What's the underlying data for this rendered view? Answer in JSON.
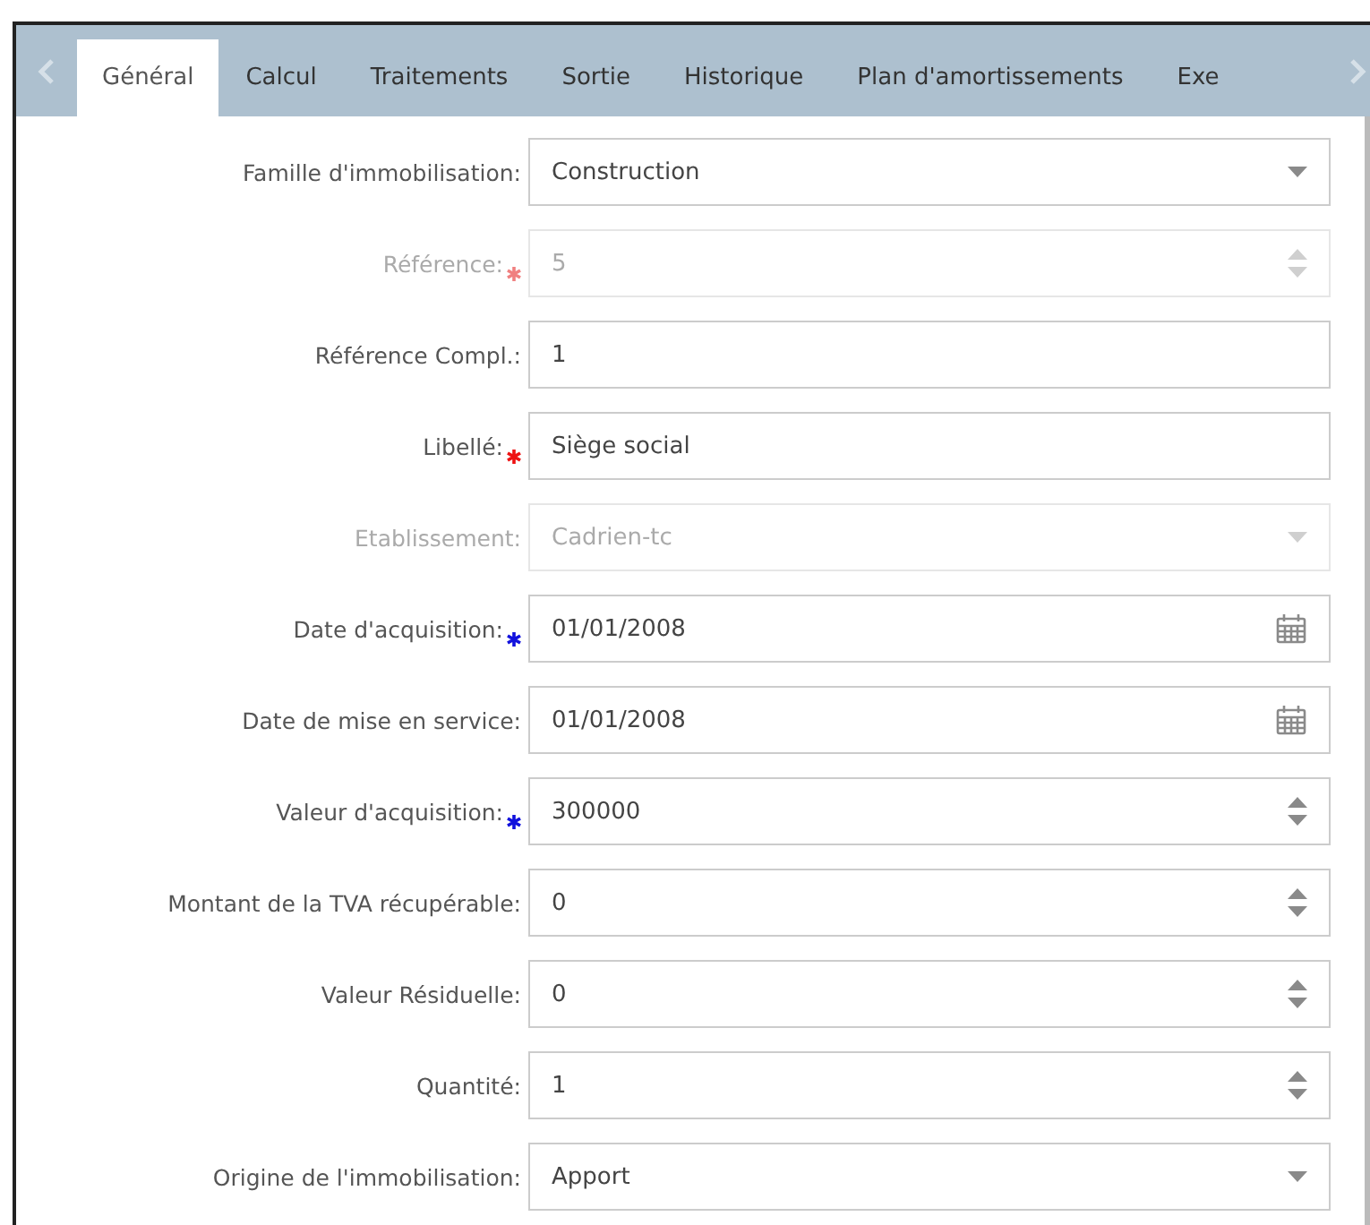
{
  "tabs": [
    {
      "label": "Général",
      "selected": true
    },
    {
      "label": "Calcul",
      "selected": false
    },
    {
      "label": "Traitements",
      "selected": false
    },
    {
      "label": "Sortie",
      "selected": false
    },
    {
      "label": "Historique",
      "selected": false
    },
    {
      "label": "Plan d'amortissements",
      "selected": false
    },
    {
      "label": "Exe",
      "selected": false
    }
  ],
  "fields": [
    {
      "label": "Famille d'immobilisation:",
      "value": "Construction",
      "kind": "select",
      "disabled": false,
      "required": false
    },
    {
      "label": "Référence:",
      "value": "5",
      "kind": "number",
      "disabled": true,
      "required": true,
      "color": "#f08080"
    },
    {
      "label": "Référence Compl.:",
      "value": "1",
      "kind": "text",
      "disabled": false,
      "required": false
    },
    {
      "label": "Libellé:",
      "value": "Siège social",
      "kind": "text",
      "disabled": false,
      "required": true,
      "color": "#ee1111"
    },
    {
      "label": "Etablissement:",
      "value": "Cadrien-tc",
      "kind": "select",
      "disabled": true,
      "required": false
    },
    {
      "label": "Date d'acquisition:",
      "value": "01/01/2008",
      "kind": "date",
      "disabled": false,
      "required": true,
      "color": "#1111dd"
    },
    {
      "label": "Date de mise en service:",
      "value": "01/01/2008",
      "kind": "date",
      "disabled": false,
      "required": false
    },
    {
      "label": "Valeur d'acquisition:",
      "value": "300000",
      "kind": "number",
      "disabled": false,
      "required": true,
      "color": "#1111dd"
    },
    {
      "label": "Montant de la TVA récupérable:",
      "value": "0",
      "kind": "number",
      "disabled": false,
      "required": false
    },
    {
      "label": "Valeur Résiduelle:",
      "value": "0",
      "kind": "number",
      "disabled": false,
      "required": false
    },
    {
      "label": "Quantité:",
      "value": "1",
      "kind": "number",
      "disabled": false,
      "required": false
    },
    {
      "label": "Origine de l'immobilisation:",
      "value": "Apport",
      "kind": "select",
      "disabled": false,
      "required": false
    }
  ]
}
